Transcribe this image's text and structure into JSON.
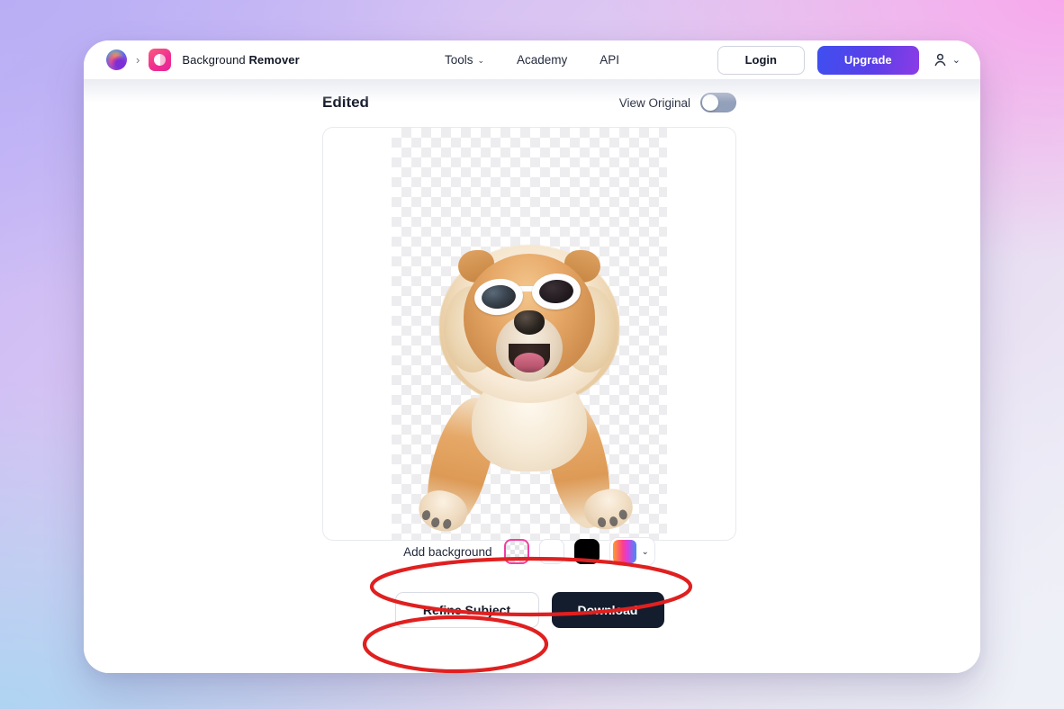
{
  "header": {
    "brand": {
      "orb_icon": "rainbow-orb-logo-icon",
      "separator": "›",
      "tile_icon": "background-remover-tile-icon",
      "name_light": "Background ",
      "name_bold": "Remover"
    },
    "nav": [
      {
        "label": "Tools",
        "has_caret": true,
        "caret": "⌄"
      },
      {
        "label": "Academy",
        "has_caret": false
      },
      {
        "label": "API",
        "has_caret": false
      }
    ],
    "login_label": "Login",
    "upgrade_label": "Upgrade",
    "account_icon": "person-icon",
    "account_caret": "⌄"
  },
  "panel": {
    "title": "Edited",
    "view_original_label": "View Original",
    "toggle_state": "off"
  },
  "canvas": {
    "image_alt": "chow chow dog wearing white sunglasses on transparent background",
    "background": "transparent-checkerboard"
  },
  "background_picker": {
    "label": "Add background",
    "swatches": [
      {
        "name": "transparent",
        "selected": true,
        "color": "transparent"
      },
      {
        "name": "white",
        "selected": false,
        "color": "#ffffff"
      },
      {
        "name": "black",
        "selected": false,
        "color": "#000000"
      }
    ],
    "custom": {
      "name": "color-gradient",
      "gradient": "#ff9a2e,#fb3f8f,#d63fe0,#3f8ff5",
      "caret": "⌄"
    }
  },
  "actions": {
    "refine_label": "Refine Subject",
    "download_label": "Download"
  },
  "annotations": [
    {
      "name": "highlight-add-background",
      "shape": "ellipse",
      "color": "#e02020"
    },
    {
      "name": "highlight-refine-subject",
      "shape": "ellipse",
      "color": "#e02020"
    }
  ],
  "colors": {
    "accent_upgrade_from": "#3f4ff0",
    "accent_upgrade_to": "#8b3ce6",
    "selected_swatch_border": "#ef3fa0",
    "download_bg": "#141d2e",
    "annotation": "#e02020"
  }
}
